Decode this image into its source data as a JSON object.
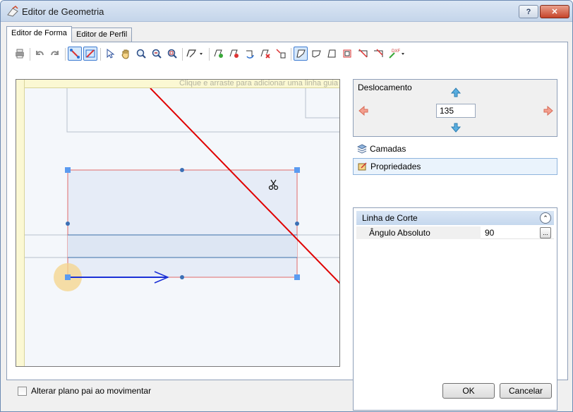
{
  "window": {
    "title": "Editor de Geometria"
  },
  "tabs": [
    {
      "label": "Editor de Forma",
      "active": true
    },
    {
      "label": "Editor de Perfil",
      "active": false
    }
  ],
  "toolbar": {
    "tools": [
      "print-icon",
      "undo-icon",
      "redo-icon",
      "snap-icon",
      "snap-angle-icon",
      "select-icon",
      "pan-icon",
      "zoom-icon",
      "zoom-out-icon",
      "zoom-fit-icon",
      "polyline-icon",
      "add-point-icon",
      "remove-point-icon",
      "rotate-icon",
      "delete-icon",
      "transform-icon",
      "shape-a-icon",
      "shape-b-icon",
      "shape-c-icon",
      "shape-d-icon",
      "cut-a-icon",
      "cut-b-icon",
      "dxf-icon"
    ]
  },
  "canvas": {
    "ruler_hint": "Clique e arraste para adicionar uma linha guia",
    "colors": {
      "cut_line": "#e00000",
      "direction_arrow": "#1a2fd6",
      "shape_fill": "#e6ecf7",
      "shape_stroke": "#e06a6a",
      "handle": "#5b9bf0",
      "origin": "#f5d48a"
    }
  },
  "offset": {
    "label": "Deslocamento",
    "value": "135"
  },
  "panels": {
    "layers_label": "Camadas",
    "properties_label": "Propriedades"
  },
  "properties": {
    "section_title": "Linha de Corte",
    "rows": [
      {
        "name": "Ângulo Absoluto",
        "value": "90",
        "button": "..."
      }
    ]
  },
  "footer": {
    "checkbox_label": "Alterar plano pai ao movimentar",
    "ok_label": "OK",
    "cancel_label": "Cancelar"
  }
}
